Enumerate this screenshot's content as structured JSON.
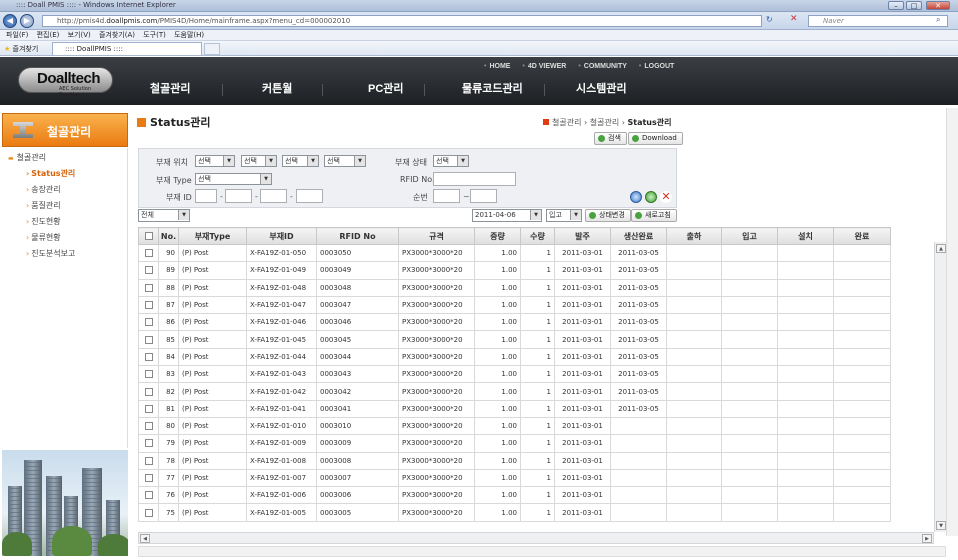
{
  "browser": {
    "title": ":::: Doall PMIS :::: - Windows Internet Explorer",
    "url_prefix": "http://pmis4d.",
    "url_domain": "doallpmis.com",
    "url_rest": "/PMIS4D/Home/mainframe.aspx?menu_cd=000002010",
    "search_placeholder": "Naver",
    "menus": [
      "파일(F)",
      "편집(E)",
      "보기(V)",
      "즐겨찾기(A)",
      "도구(T)",
      "도움말(H)"
    ],
    "favorites_label": "즐겨찾기",
    "tab_title": ":::: DoallPMIS ::::"
  },
  "header": {
    "logo": "Doalltech",
    "logo_sub": "AEC Solution Provider",
    "top_links": [
      "HOME",
      "4D VIEWER",
      "COMMUNITY",
      "LOGOUT"
    ],
    "gnb": [
      "철골관리",
      "커튼월",
      "PC관리",
      "물류코드관리",
      "시스템관리"
    ]
  },
  "sidebar": {
    "title": "철골관리",
    "root": "철골관리",
    "items": [
      "Status관리",
      "송장관리",
      "품질관리",
      "진도현황",
      "물류현황",
      "진도분석보고"
    ],
    "active_index": 0
  },
  "page": {
    "title": "Status관리",
    "breadcrumb_1": "철골관리",
    "breadcrumb_2": "철골관리",
    "breadcrumb_3": "Status관리",
    "search_button": "검색",
    "download_button": "Download"
  },
  "filter": {
    "location_label": "부재 위치",
    "location_selects": [
      "선택",
      "선택",
      "선택",
      "선택"
    ],
    "status_label": "부재 상태",
    "status_select": "선택",
    "type_label": "부재 Type",
    "type_select": "선택",
    "rfid_label": "RFID No.",
    "id_label": "부재 ID",
    "seq_label": "순번",
    "id_sep": "-",
    "seq_sep": "~"
  },
  "toolbar": {
    "view_select": "전체",
    "date": "2011-04-06",
    "state_select": "입고",
    "status_change_button": "상태변경",
    "refresh_button": "새로고침"
  },
  "table": {
    "headers": [
      "",
      "No.",
      "부재Type",
      "부재ID",
      "RFID No",
      "규격",
      "중량",
      "수량",
      "발주",
      "생산완료",
      "출하",
      "입고",
      "설치",
      "완료"
    ],
    "rows": [
      [
        "90",
        "(P) Post",
        "X-FA19Z-01-050",
        "0003050",
        "PX3000*3000*20",
        "1.00",
        "1",
        "2011-03-01",
        "2011-03-05"
      ],
      [
        "89",
        "(P) Post",
        "X-FA19Z-01-049",
        "0003049",
        "PX3000*3000*20",
        "1.00",
        "1",
        "2011-03-01",
        "2011-03-05"
      ],
      [
        "88",
        "(P) Post",
        "X-FA19Z-01-048",
        "0003048",
        "PX3000*3000*20",
        "1.00",
        "1",
        "2011-03-01",
        "2011-03-05"
      ],
      [
        "87",
        "(P) Post",
        "X-FA19Z-01-047",
        "0003047",
        "PX3000*3000*20",
        "1.00",
        "1",
        "2011-03-01",
        "2011-03-05"
      ],
      [
        "86",
        "(P) Post",
        "X-FA19Z-01-046",
        "0003046",
        "PX3000*3000*20",
        "1.00",
        "1",
        "2011-03-01",
        "2011-03-05"
      ],
      [
        "85",
        "(P) Post",
        "X-FA19Z-01-045",
        "0003045",
        "PX3000*3000*20",
        "1.00",
        "1",
        "2011-03-01",
        "2011-03-05"
      ],
      [
        "84",
        "(P) Post",
        "X-FA19Z-01-044",
        "0003044",
        "PX3000*3000*20",
        "1.00",
        "1",
        "2011-03-01",
        "2011-03-05"
      ],
      [
        "83",
        "(P) Post",
        "X-FA19Z-01-043",
        "0003043",
        "PX3000*3000*20",
        "1.00",
        "1",
        "2011-03-01",
        "2011-03-05"
      ],
      [
        "82",
        "(P) Post",
        "X-FA19Z-01-042",
        "0003042",
        "PX3000*3000*20",
        "1.00",
        "1",
        "2011-03-01",
        "2011-03-05"
      ],
      [
        "81",
        "(P) Post",
        "X-FA19Z-01-041",
        "0003041",
        "PX3000*3000*20",
        "1.00",
        "1",
        "2011-03-01",
        "2011-03-05"
      ],
      [
        "80",
        "(P) Post",
        "X-FA19Z-01-010",
        "0003010",
        "PX3000*3000*20",
        "1.00",
        "1",
        "2011-03-01",
        ""
      ],
      [
        "79",
        "(P) Post",
        "X-FA19Z-01-009",
        "0003009",
        "PX3000*3000*20",
        "1.00",
        "1",
        "2011-03-01",
        ""
      ],
      [
        "78",
        "(P) Post",
        "X-FA19Z-01-008",
        "0003008",
        "PX3000*3000*20",
        "1.00",
        "1",
        "2011-03-01",
        ""
      ],
      [
        "77",
        "(P) Post",
        "X-FA19Z-01-007",
        "0003007",
        "PX3000*3000*20",
        "1.00",
        "1",
        "2011-03-01",
        ""
      ],
      [
        "76",
        "(P) Post",
        "X-FA19Z-01-006",
        "0003006",
        "PX3000*3000*20",
        "1.00",
        "1",
        "2011-03-01",
        ""
      ],
      [
        "75",
        "(P) Post",
        "X-FA19Z-01-005",
        "0003005",
        "PX3000*3000*20",
        "1.00",
        "1",
        "2011-03-01",
        ""
      ]
    ]
  },
  "colors": {
    "accent_orange": "#ea7b12",
    "header_dark": "#2b2f33"
  }
}
